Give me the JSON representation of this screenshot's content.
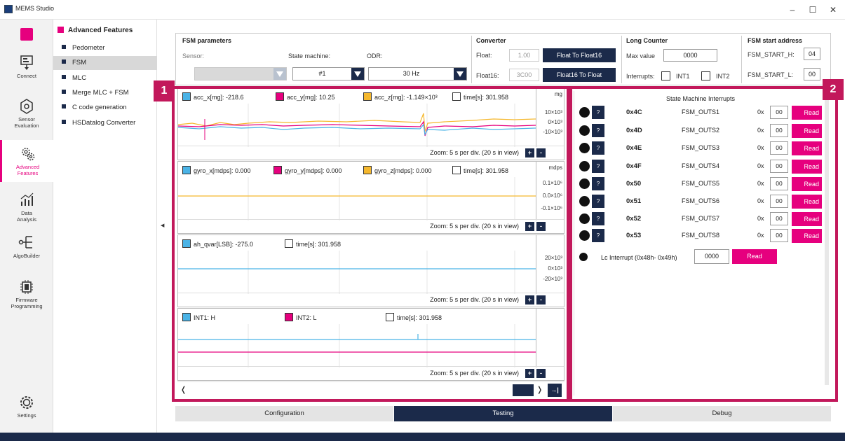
{
  "window": {
    "title": "MEMS Studio",
    "minimize": "–",
    "maximize": "☐",
    "close": "✕"
  },
  "leftnav": [
    {
      "label": "Connect",
      "icon": "connect-icon"
    },
    {
      "label": "Sensor\nEvaluation",
      "icon": "sensor-evaluation-icon"
    },
    {
      "label": "Advanced\nFeatures",
      "icon": "advanced-features-icon",
      "active": true
    },
    {
      "label": "Data\nAnalysis",
      "icon": "data-analysis-icon"
    },
    {
      "label": "AlgoBuilder",
      "icon": "algobuilder-icon"
    },
    {
      "label": "Firmware\nProgramming",
      "icon": "firmware-programming-icon"
    },
    {
      "label": "Settings",
      "icon": "settings-icon"
    }
  ],
  "subnav": {
    "header": "Advanced Features",
    "items": [
      "Pedometer",
      "FSM",
      "MLC",
      "Merge MLC + FSM",
      "C code generation",
      "HSDatalog Converter"
    ],
    "active": "FSM"
  },
  "fsm_params": {
    "title": "FSM parameters",
    "sensor_label": "Sensor:",
    "sensor_value": "",
    "state_machine_label": "State machine:",
    "state_machine_value": "#1",
    "odr_label": "ODR:",
    "odr_value": "30 Hz"
  },
  "converter": {
    "title": "Converter",
    "float_label": "Float:",
    "float_value": "1.00",
    "float_btn": "Float To Float16",
    "float16_label": "Float16:",
    "float16_value": "3C00",
    "float16_btn": "Float16 To Float"
  },
  "long_counter": {
    "title": "Long Counter",
    "max_label": "Max value",
    "max_value": "0000",
    "interrupts_label": "Interrupts:",
    "int1": "INT1",
    "int2": "INT2"
  },
  "fsm_start": {
    "title": "FSM start address",
    "h_label": "FSM_START_H:",
    "h_value": "04",
    "l_label": "FSM_START_L:",
    "l_value": "00"
  },
  "callouts": {
    "left": "1",
    "right": "2"
  },
  "plots": [
    {
      "legend": [
        {
          "text": "acc_x[mg]: -218.6",
          "color": "#4ab3e6"
        },
        {
          "text": "acc_y[mg]: 10.25",
          "color": "#e6007e"
        },
        {
          "text": "acc_z[mg]: -1.149×10³",
          "color": "#f5b82e"
        },
        {
          "text": "time[s]: 301.958",
          "color": "#ffffff"
        }
      ],
      "unit": "mg",
      "ticks": [
        "10×10³",
        "0×10³",
        "-10×10³"
      ],
      "zoom": "Zoom: 5 s per div. (20 s in view)"
    },
    {
      "legend": [
        {
          "text": "gyro_x[mdps]: 0.000",
          "color": "#4ab3e6"
        },
        {
          "text": "gyro_y[mdps]: 0.000",
          "color": "#e6007e"
        },
        {
          "text": "gyro_z[mdps]: 0.000",
          "color": "#f5b82e"
        },
        {
          "text": "time[s]: 301.958",
          "color": "#ffffff"
        }
      ],
      "unit": "mdps",
      "ticks": [
        "0.1×10⁶",
        "0.0×10⁶",
        "-0.1×10⁶"
      ],
      "zoom": "Zoom: 5 s per div. (20 s in view)"
    },
    {
      "legend": [
        {
          "text": "ah_qvar[LSB]: -275.0",
          "color": "#4ab3e6"
        },
        {
          "text": "time[s]: 301.958",
          "color": "#ffffff"
        }
      ],
      "unit": "",
      "ticks": [
        "20×10³",
        "0×10³",
        "-20×10³"
      ],
      "zoom": "Zoom: 5 s per div. (20 s in view)"
    },
    {
      "legend": [
        {
          "text": "INT1: H",
          "color": "#4ab3e6"
        },
        {
          "text": "INT2: L",
          "color": "#e6007e"
        },
        {
          "text": "time[s]: 301.958",
          "color": "#ffffff"
        }
      ],
      "unit": "",
      "ticks": [],
      "zoom": "Zoom: 5 s per div. (20 s in view)"
    }
  ],
  "zoom_plus": "+",
  "zoom_minus": "-",
  "scroll": {
    "left": "❬",
    "right": "❭",
    "end": "→|"
  },
  "interrupts": {
    "title": "State Machine Interrupts",
    "q": "?",
    "ox": "0x",
    "read": "Read",
    "rows": [
      {
        "addr": "0x4C",
        "reg": "FSM_OUTS1",
        "val": "00"
      },
      {
        "addr": "0x4D",
        "reg": "FSM_OUTS2",
        "val": "00"
      },
      {
        "addr": "0x4E",
        "reg": "FSM_OUTS3",
        "val": "00"
      },
      {
        "addr": "0x4F",
        "reg": "FSM_OUTS4",
        "val": "00"
      },
      {
        "addr": "0x50",
        "reg": "FSM_OUTS5",
        "val": "00"
      },
      {
        "addr": "0x51",
        "reg": "FSM_OUTS6",
        "val": "00"
      },
      {
        "addr": "0x52",
        "reg": "FSM_OUTS7",
        "val": "00"
      },
      {
        "addr": "0x53",
        "reg": "FSM_OUTS8",
        "val": "00"
      }
    ],
    "lc_label": "Lc Interrupt (0x48h- 0x49h)",
    "lc_value": "0000",
    "lc_read": "Read"
  },
  "tabs": {
    "items": [
      "Configuration",
      "Testing",
      "Debug"
    ],
    "active": "Testing"
  },
  "colors": {
    "accent": "#e6007e",
    "navy": "#1b2a4a",
    "highlight": "#c2185b",
    "series_x": "#4ab3e6",
    "series_y": "#e6007e",
    "series_z": "#f5b82e"
  }
}
